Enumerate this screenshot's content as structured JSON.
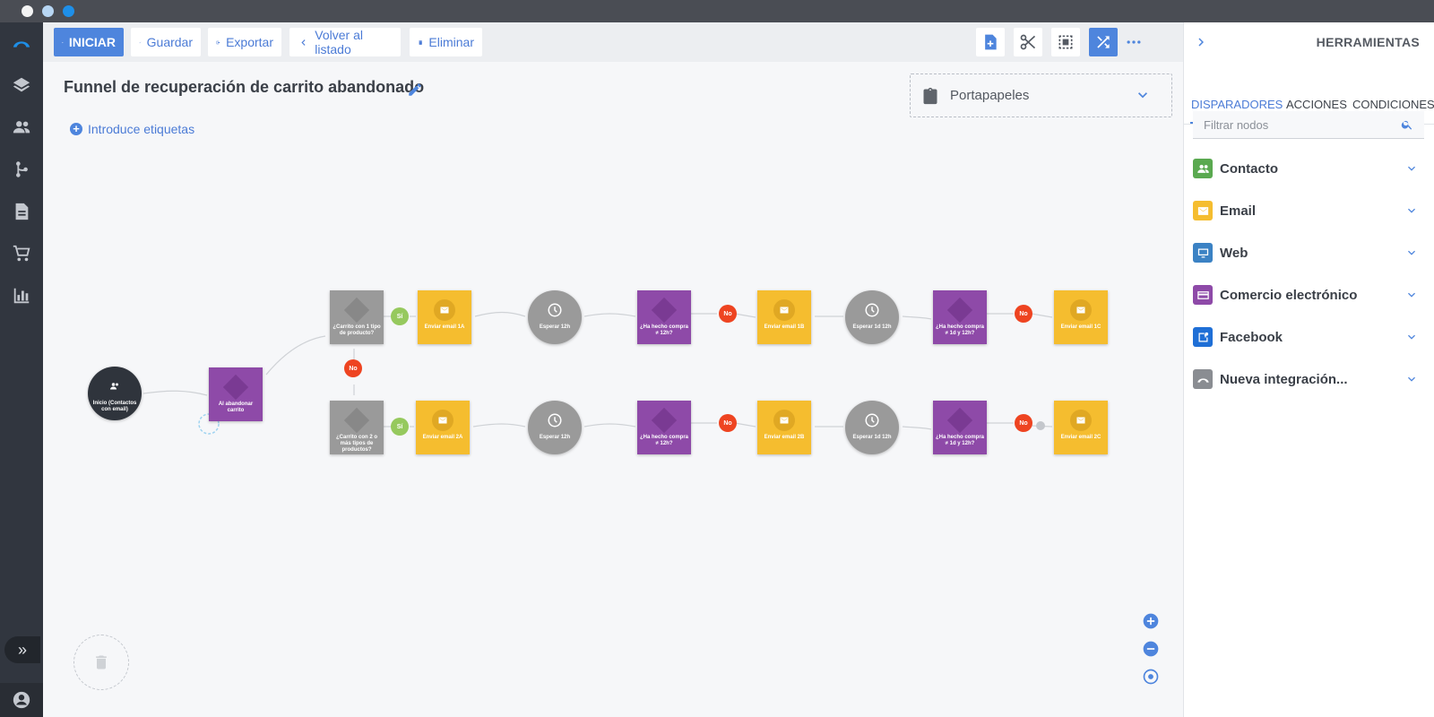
{
  "toolbar": {
    "start_label": "INICIAR",
    "save_label": "Guardar",
    "export_label": "Exportar",
    "back_label": "Volver al listado",
    "delete_label": "Eliminar"
  },
  "canvas": {
    "title": "Funnel de recuperación de carrito abandonado",
    "tags_label": "Introduce etiquetas",
    "clipboard_label": "Portapapeles"
  },
  "flow": {
    "start_node": "Inicio (Contactos con email)",
    "trigger_node": "Al abandonar carrito",
    "row1": {
      "condition": "¿Carrito con 1 tipo de producto?",
      "yes": "Sí",
      "email_a": "Enviar email 1A",
      "wait_a": "Esperar 12h",
      "check_a": "¿Ha hecho compra ≠ 12h?",
      "no_a": "No",
      "email_b": "Enviar email 1B",
      "wait_b": "Esperar 1d 12h",
      "check_b": "¿Ha hecho compra ≠ 1d y 12h?",
      "no_b": "No",
      "email_c": "Enviar email 1C"
    },
    "branch_no": "No",
    "row2": {
      "condition": "¿Carrito con 2 o más tipos de productos?",
      "yes": "Sí",
      "email_a": "Enviar email 2A",
      "wait_a": "Esperar 12h",
      "check_a": "¿Ha hecho compra ≠ 12h?",
      "no_a": "No",
      "email_b": "Enviar email 2B",
      "wait_b": "Esperar 1d 12h",
      "check_b": "¿Ha hecho compra ≠ 1d y 12h?",
      "no_b": "No",
      "email_c": "Enviar email 2C"
    }
  },
  "panel": {
    "title": "HERRAMIENTAS",
    "tabs": [
      "DISPARADORES",
      "ACCIONES",
      "CONDICIONES"
    ],
    "search_placeholder": "Filtrar nodos",
    "categories": [
      {
        "label": "Contacto",
        "color": "#5aa950",
        "icon": "people-icon"
      },
      {
        "label": "Email",
        "color": "#f5bd2f",
        "icon": "mail-icon"
      },
      {
        "label": "Web",
        "color": "#3b82c4",
        "icon": "monitor-icon"
      },
      {
        "label": "Comercio electrónico",
        "color": "#8e4aa8",
        "icon": "card-icon"
      },
      {
        "label": "Facebook",
        "color": "#1f6fd6",
        "icon": "facebook-icon"
      },
      {
        "label": "Nueva integración...",
        "color": "#8a8d92",
        "icon": "integration-icon"
      }
    ]
  },
  "colors": {
    "accent": "#4e85dd",
    "condition": "#9a9a9a",
    "ecommerce": "#8e4aa8",
    "email": "#f5bd2f",
    "yes": "#96c95e",
    "no": "#ee4421"
  }
}
